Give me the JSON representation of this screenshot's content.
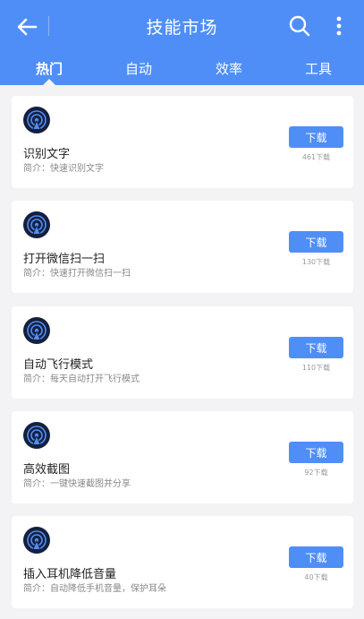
{
  "header": {
    "title": "技能市场",
    "back_icon": "arrow-left-icon",
    "search_icon": "search-icon",
    "more_icon": "more-vertical-icon",
    "bg_color": "#4f8ef7"
  },
  "tabs": [
    {
      "label": "热门",
      "active": true
    },
    {
      "label": "自动",
      "active": false
    },
    {
      "label": "效率",
      "active": false
    },
    {
      "label": "工具",
      "active": false
    }
  ],
  "skills": [
    {
      "name": "识别文字",
      "desc": "简介：快速识别文字",
      "button": "下载",
      "downloads": "461下载"
    },
    {
      "name": "打开微信扫一扫",
      "desc": "简介：快速打开微信扫一扫",
      "button": "下载",
      "downloads": "130下载"
    },
    {
      "name": "自动飞行模式",
      "desc": "简介：每天自动打开飞行模式",
      "button": "下载",
      "downloads": "110下载"
    },
    {
      "name": "高效截图",
      "desc": "简介：一键快速截图并分享",
      "button": "下载",
      "downloads": "92下载"
    },
    {
      "name": "插入耳机降低音量",
      "desc": "简介：自动降低手机音量，保护耳朵",
      "button": "下载",
      "downloads": "40下载"
    }
  ]
}
